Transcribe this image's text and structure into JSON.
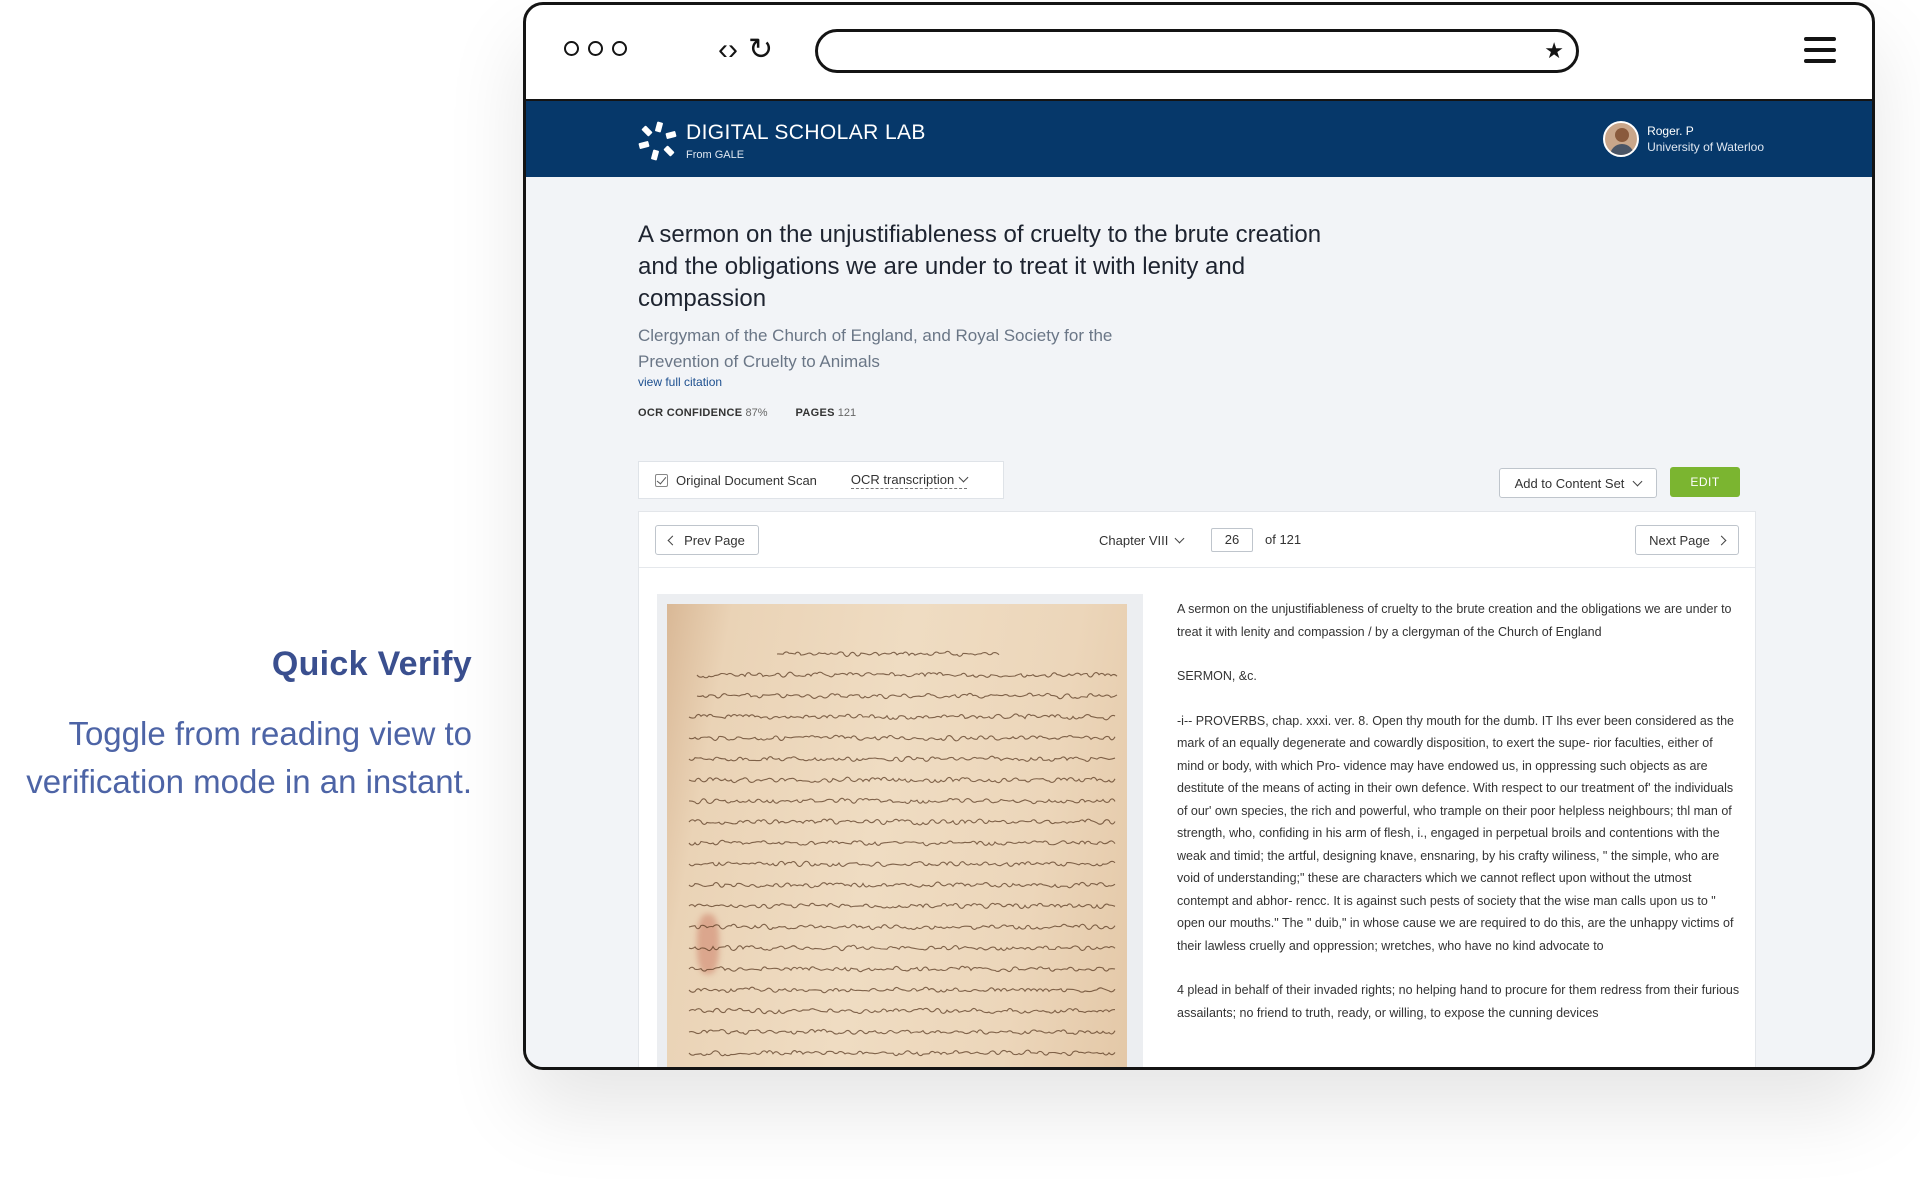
{
  "caption": {
    "title": "Quick Verify",
    "text": "Toggle from reading view to verification mode in an instant."
  },
  "browser": {
    "icons": [
      "window-dots",
      "code-icon",
      "reload-icon",
      "star-icon",
      "hamburger-menu-icon"
    ]
  },
  "header": {
    "brand": "DIGITAL SCHOLAR LAB",
    "brand_sub": "From GALE",
    "user_name": "Roger. P",
    "user_org": "University of Waterloo"
  },
  "document": {
    "title": "A sermon on the unjustifiableness of cruelty to the brute creation and the obligations we are under to treat it with lenity and compassion",
    "author": "Clergyman of the Church of England, and Royal Society for the Prevention of Cruelty to Animals",
    "citation_link": "view full citation",
    "ocr_label": "OCR CONFIDENCE",
    "ocr_value": "87%",
    "pages_label": "PAGES",
    "pages_value": "121"
  },
  "toolbar": {
    "original_scan": "Original Document Scan",
    "ocr_transcription": "OCR transcription",
    "add_to_set": "Add to Content Set",
    "edit": "EDIT"
  },
  "viewer": {
    "prev": "Prev Page",
    "next": "Next Page",
    "chapter": "Chapter VIII",
    "page": "26",
    "of_total": "of 121",
    "ocr_paragraphs": [
      "A sermon on the unjustifiableness of cruelty to the brute creation and the obligations we are under to treat it with lenity and compassion / by a clergyman of the Church of England",
      "SERMON, &c.",
      "-i-- PROVERBS, chap. xxxi. ver. 8. Open thy mouth for the dumb. IT Ihs ever been considered as the mark of an equally degenerate and cowardly disposition, to exert the supe- rior faculties, either of mind or body, with which Pro- vidence may have endowed us, in oppressing such objects as are destitute of the means of acting in their own defence. With respect to our treatment of' the individuals of our' own species, the rich and powerful, who trample on their poor helpless neighbours; thl man of strength, who, confiding in his arm of flesh, i., engaged in perpetual broils and contentions with the weak and timid; the artful, designing knave, ensnaring, by his crafty wiliness, \" the simple, who are void of understanding;\" these are characters which we cannot reflect upon without the utmost contempt and abhor- rencc. It is against such pests of society that the wise man calls upon us to \" open our mouths.\" The \" duib,\" in whose cause we are required to do this, are the unhappy victims of their lawless cruelly and oppression; wretches, who have no kind advocate to",
      "4 plead in behalf of their invaded rights; no helping hand to procure for them redress from their furious assailants; no friend to truth, ready, or willing, to expose the cunning devices"
    ]
  }
}
